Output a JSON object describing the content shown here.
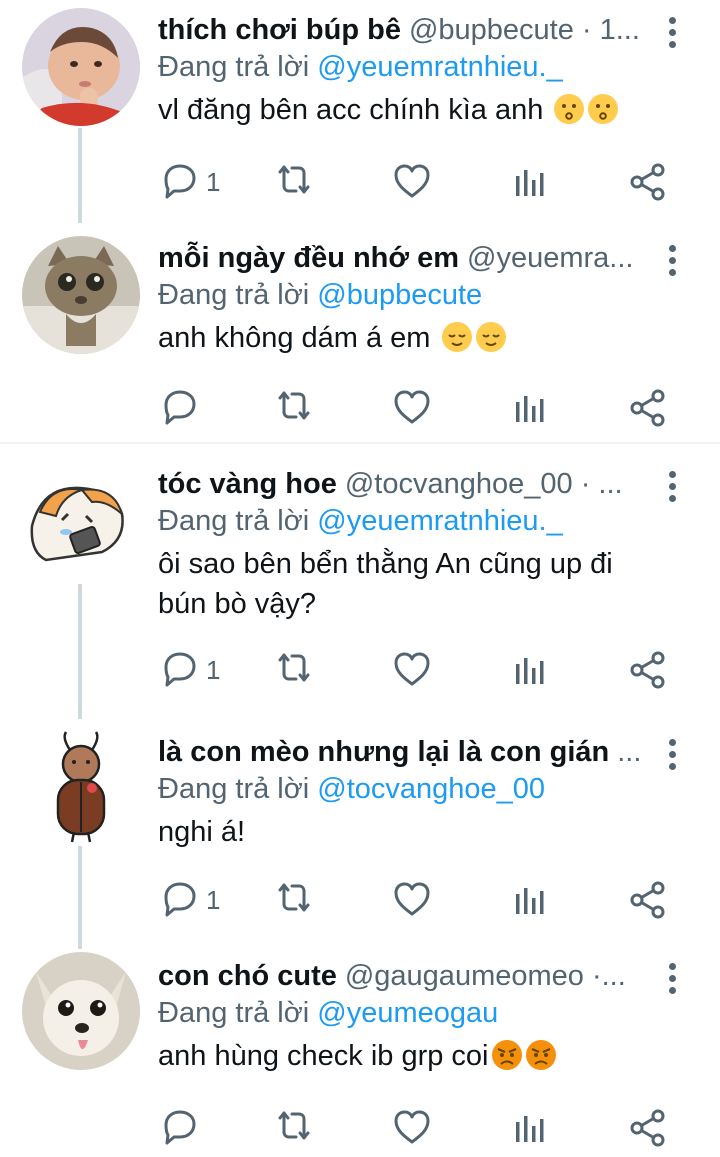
{
  "colors": {
    "mention": "#1d9bf0",
    "secondary": "#536471",
    "primary": "#0f1419",
    "thread_line": "#cfd9de"
  },
  "replying_prefix": "Đang trả lời",
  "tweets": [
    {
      "name": "thích chơi búp bê",
      "handle": "@bupbecute · 1...",
      "replying_to": "@yeuemratnhieu._",
      "text": "vl đăng bên acc chính kìa anh",
      "emoji": "kissing-face",
      "reply_count": "1",
      "avatar": "baby-photo"
    },
    {
      "name": "mỗi ngày đều nhớ em",
      "handle": "@yeuemra...",
      "replying_to": "@bupbecute",
      "text": "anh không dám á em",
      "emoji": "relieved-face",
      "reply_count": "",
      "avatar": "cat-photo"
    },
    {
      "name": "tóc vàng hoe",
      "handle": "@tocvanghoe_00 · ...",
      "replying_to": "@yeuemratnhieu._",
      "text": "ôi sao bên bển thằng An cũng up đi bún bò vậy?",
      "reply_count": "1",
      "avatar": "cartoon-dog"
    },
    {
      "name": "là con mèo nhưng lại là con gián",
      "handle": "...",
      "replying_to": "@tocvanghoe_00",
      "text": "nghi á!",
      "reply_count": "1",
      "avatar": "cartoon-cockroach"
    },
    {
      "name": "con chó cute",
      "handle": "@gaugaumeomeo ·...",
      "replying_to": "@yeumeogau",
      "text": "anh hùng check ib grp coi",
      "emoji": "angry-face",
      "reply_count": "",
      "avatar": "chihuahua-photo"
    }
  ]
}
